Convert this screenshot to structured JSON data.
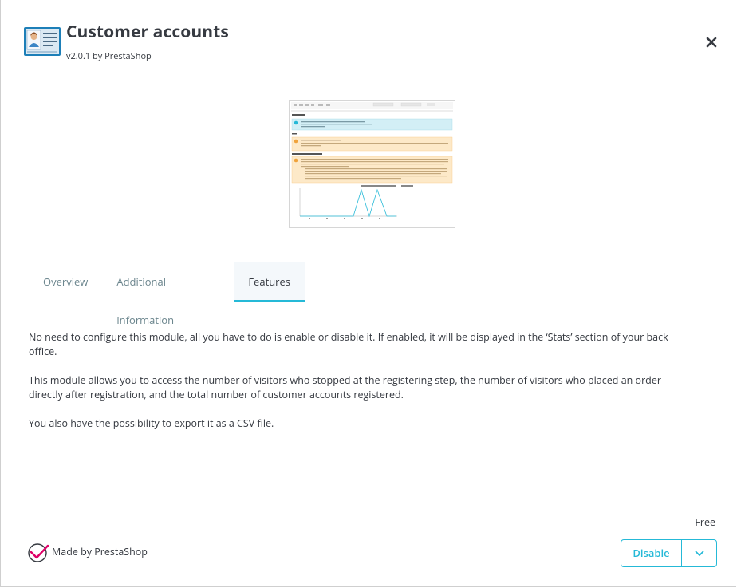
{
  "module": {
    "title": "Customer accounts",
    "version_line": "v2.0.1 by PrestaShop",
    "icon": "customer-accounts-icon"
  },
  "tabs": [
    {
      "label": "Overview",
      "active": false
    },
    {
      "label": "Additional information",
      "active": false
    },
    {
      "label": "Features",
      "active": true
    }
  ],
  "features": {
    "paragraphs": [
      "No need to configure this module, all you have to do is enable or disable it. If enabled, it will be displayed in the ‘Stats’ section of your back office.",
      "This module allows you to access the number of visitors who stopped at the registering step, the number of visitors who placed an order directly after registration, and the total number of customer accounts registered.",
      "You also have the possibility to export it as a CSV file."
    ]
  },
  "footer": {
    "price": "Free",
    "made_by": "Made by PrestaShop",
    "disable_label": "Disable"
  },
  "colors": {
    "accent": "#25b9d7",
    "text": "#363a41",
    "tab_inactive": "#6c868e",
    "brand_pink": "#df0067"
  }
}
